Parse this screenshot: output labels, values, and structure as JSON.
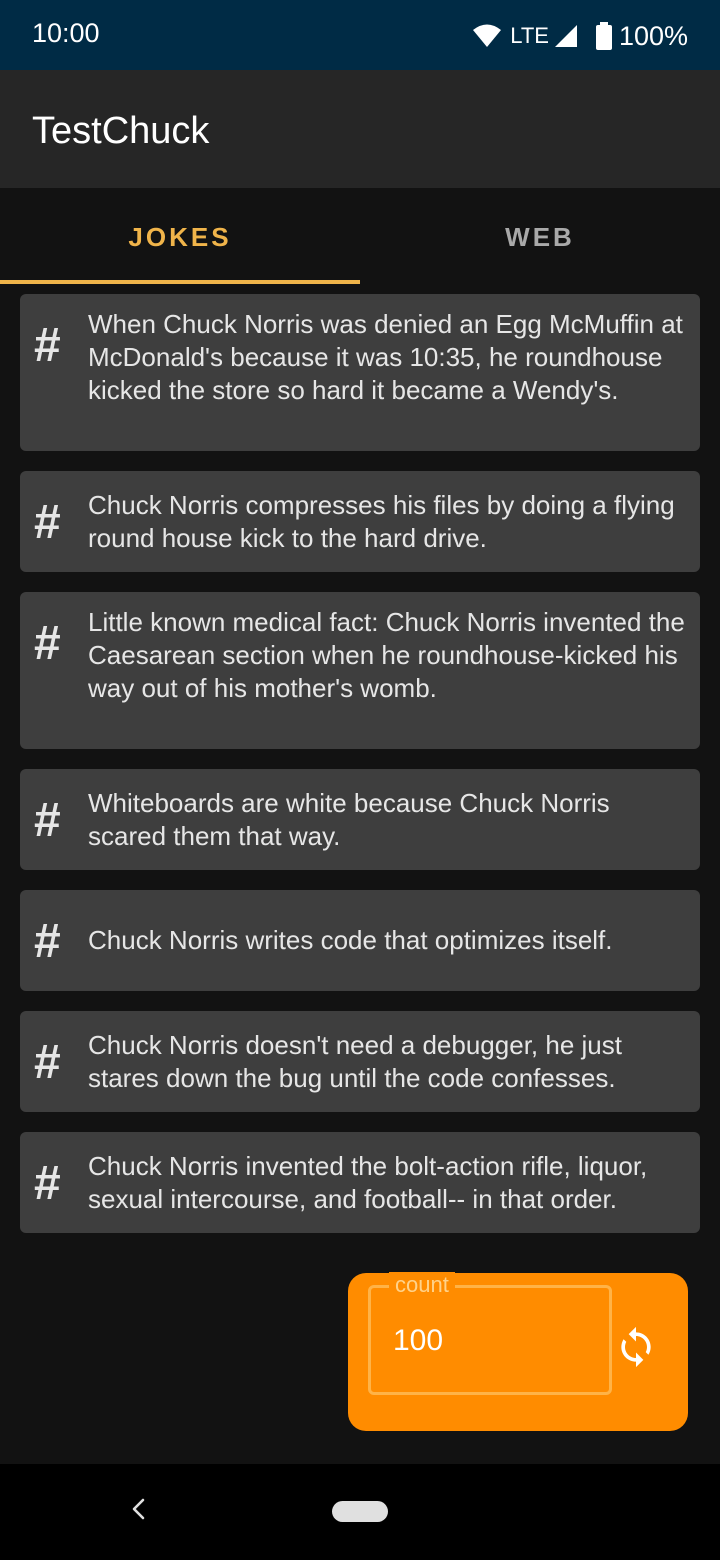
{
  "status": {
    "time": "10:00",
    "network": "LTE",
    "battery": "100%"
  },
  "app": {
    "title": "TestChuck"
  },
  "tabs": [
    {
      "label": "JOKES",
      "selected": true
    },
    {
      "label": "WEB",
      "selected": false
    }
  ],
  "jokes": [
    {
      "icon": "#",
      "text": "When Chuck Norris was denied an Egg McMuffin at McDonald's because it was 10:35, he roundhouse kicked the store so hard it became a Wendy's."
    },
    {
      "icon": "#",
      "text": "Chuck Norris compresses his files by doing a flying round house kick to the hard drive."
    },
    {
      "icon": "#",
      "text": "Little known medical fact: Chuck Norris invented the Caesarean section when he roundhouse-kicked his way out of his mother's womb."
    },
    {
      "icon": "#",
      "text": "Whiteboards are white because Chuck Norris scared them that way."
    },
    {
      "icon": "#",
      "text": "Chuck Norris writes code that optimizes itself."
    },
    {
      "icon": "#",
      "text": "Chuck Norris doesn't need a debugger, he just stares down the bug until the code confesses."
    },
    {
      "icon": "#",
      "text": "Chuck Norris invented the bolt-action rifle, liquor, sexual intercourse, and football-- in that order."
    }
  ],
  "count_field": {
    "label": "count",
    "value": "100"
  },
  "icons": {
    "refresh": "refresh-icon",
    "back": "back-icon",
    "wifi": "wifi-icon",
    "signal": "signal-icon",
    "battery": "battery-icon"
  },
  "colors": {
    "accent": "#f0b44a",
    "panel": "#ff8c00",
    "card": "#3e3e3e",
    "status_bar": "#002b45"
  }
}
